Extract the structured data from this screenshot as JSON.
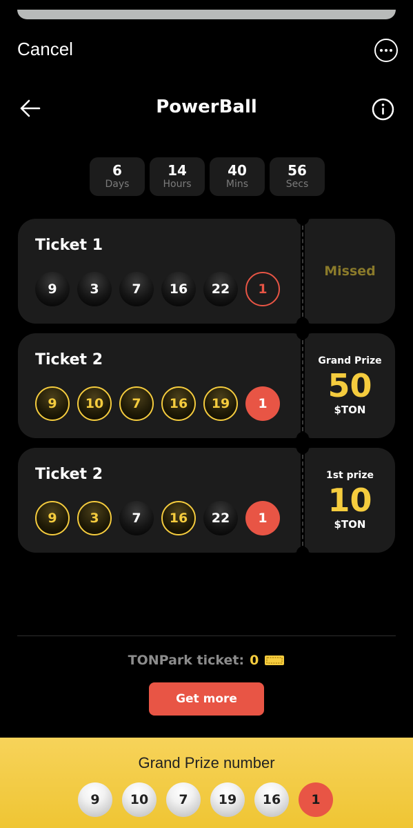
{
  "header": {
    "cancel_label": "Cancel",
    "more_icon": "more-horizontal-icon",
    "back_icon": "arrow-left-icon",
    "title": "PowerBall",
    "info_icon": "info-icon"
  },
  "countdown": [
    {
      "value": "6",
      "label": "Days"
    },
    {
      "value": "14",
      "label": "Hours"
    },
    {
      "value": "40",
      "label": "Mins"
    },
    {
      "value": "56",
      "label": "Secs"
    }
  ],
  "tickets": [
    {
      "name": "Ticket 1",
      "balls": [
        {
          "value": "9",
          "state": "plain"
        },
        {
          "value": "3",
          "state": "plain"
        },
        {
          "value": "7",
          "state": "plain"
        },
        {
          "value": "16",
          "state": "plain"
        },
        {
          "value": "22",
          "state": "plain"
        },
        {
          "value": "1",
          "state": "power-miss"
        }
      ],
      "result": {
        "status": "Missed"
      }
    },
    {
      "name": "Ticket 2",
      "balls": [
        {
          "value": "9",
          "state": "match"
        },
        {
          "value": "10",
          "state": "match"
        },
        {
          "value": "7",
          "state": "match"
        },
        {
          "value": "16",
          "state": "match"
        },
        {
          "value": "19",
          "state": "match"
        },
        {
          "value": "1",
          "state": "power-hit"
        }
      ],
      "result": {
        "label": "Grand Prize",
        "amount": "50",
        "unit": "$TON"
      }
    },
    {
      "name": "Ticket 2",
      "balls": [
        {
          "value": "9",
          "state": "match"
        },
        {
          "value": "3",
          "state": "match"
        },
        {
          "value": "7",
          "state": "plain"
        },
        {
          "value": "16",
          "state": "match"
        },
        {
          "value": "22",
          "state": "plain"
        },
        {
          "value": "1",
          "state": "power-hit"
        }
      ],
      "result": {
        "label": "1st prize",
        "amount": "10",
        "unit": "$TON"
      }
    }
  ],
  "tonpark": {
    "label": "TONPark ticket:",
    "count": "0",
    "icon": "ticket-icon"
  },
  "get_more_label": "Get more",
  "grand_prize": {
    "title": "Grand Prize number",
    "numbers": [
      "9",
      "10",
      "7",
      "19",
      "16",
      "1"
    ]
  },
  "colors": {
    "accent_red": "#e85545",
    "accent_gold": "#f5cc3e",
    "panel_yellow": "#f3cc45",
    "card_bg": "#1c1c1c"
  }
}
